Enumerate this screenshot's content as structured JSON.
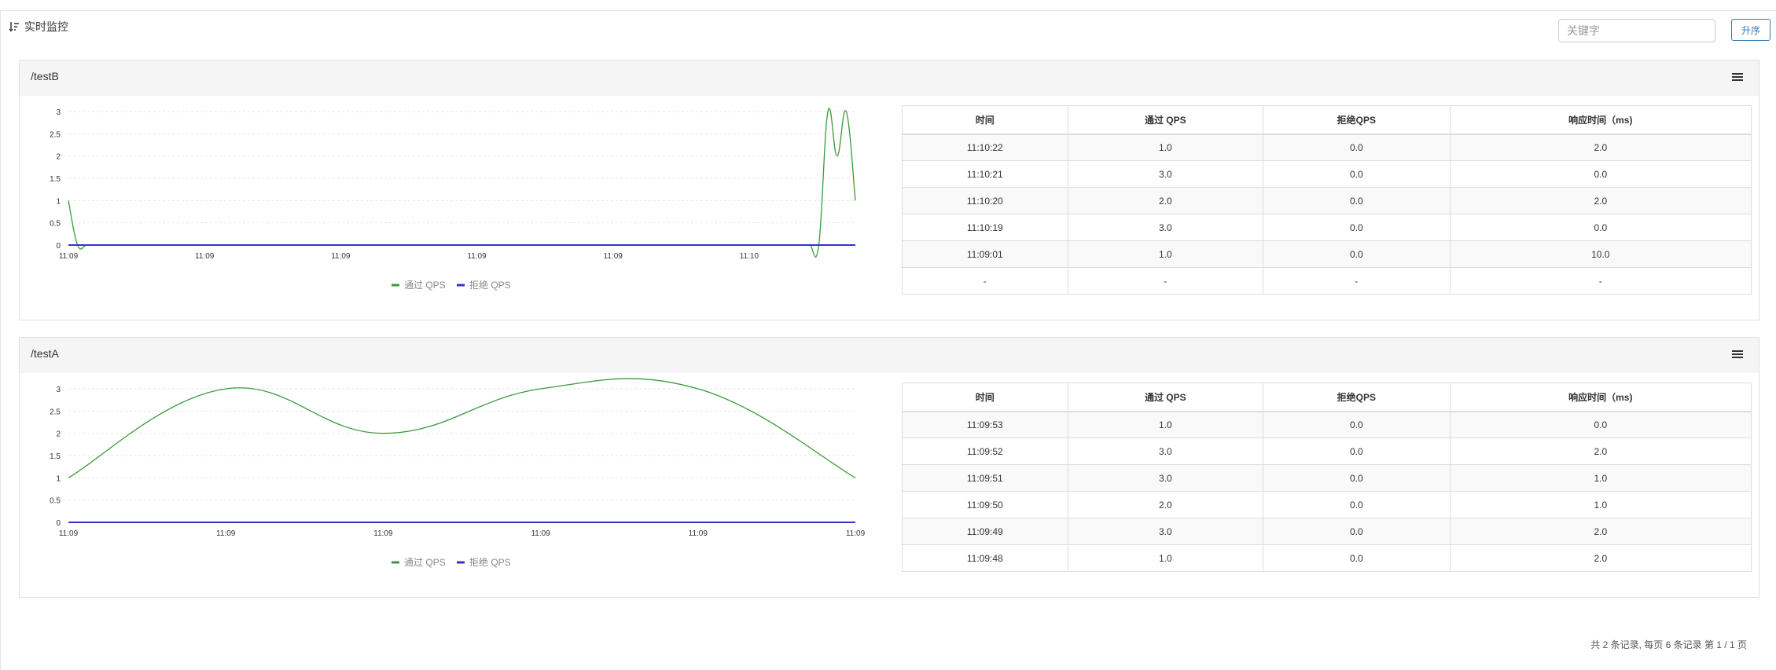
{
  "header": {
    "title": "实时监控",
    "sort_icon": "sort-icon"
  },
  "search": {
    "placeholder": "关键字",
    "value": ""
  },
  "asc_button": {
    "label": "升序"
  },
  "panels": [
    {
      "title": "/testB",
      "table": {
        "headers": [
          "时间",
          "通过 QPS",
          "拒绝QPS",
          "响应时间（ms)"
        ],
        "rows": [
          [
            "11:10:22",
            "1.0",
            "0.0",
            "2.0"
          ],
          [
            "11:10:21",
            "3.0",
            "0.0",
            "0.0"
          ],
          [
            "11:10:20",
            "2.0",
            "0.0",
            "2.0"
          ],
          [
            "11:10:19",
            "3.0",
            "0.0",
            "0.0"
          ],
          [
            "11:09:01",
            "1.0",
            "0.0",
            "10.0"
          ],
          [
            "-",
            "-",
            "-",
            "-"
          ]
        ]
      },
      "chart_data": {
        "type": "line",
        "x_tick_labels": [
          "11:09",
          "11:09",
          "11:09",
          "11:09",
          "11:09",
          "11:10"
        ],
        "y_ticks": [
          "0",
          "0.5",
          "1",
          "1.5",
          "2",
          "2.5",
          "3"
        ],
        "ylim": [
          0,
          3
        ],
        "grid": true,
        "legend_position": "bottom",
        "series": [
          {
            "name": "通过 QPS",
            "color": "#3a9a3a",
            "values": [
              1,
              0,
              0,
              0,
              0,
              0,
              0,
              0,
              0,
              0,
              0,
              0,
              0,
              0,
              0,
              0,
              0,
              0,
              0,
              0,
              0,
              0,
              0,
              0,
              0,
              0,
              0,
              0,
              0,
              0,
              0,
              0,
              0,
              0,
              0,
              0,
              0,
              0,
              0,
              0,
              0,
              0,
              0,
              0,
              0,
              0,
              0,
              0,
              0,
              0,
              0,
              0,
              0,
              0,
              0,
              0,
              0,
              0,
              0,
              0,
              0,
              0,
              0,
              0,
              0,
              0,
              0,
              0,
              0,
              0,
              0,
              0,
              0,
              0,
              0,
              0,
              0,
              0,
              0,
              0,
              0,
              0,
              0,
              3,
              2,
              3,
              1
            ]
          },
          {
            "name": "拒绝 QPS",
            "color": "#3333cc",
            "values": [
              0,
              0,
              0,
              0,
              0,
              0,
              0,
              0,
              0,
              0,
              0,
              0,
              0,
              0,
              0,
              0,
              0,
              0,
              0,
              0,
              0,
              0,
              0,
              0,
              0,
              0,
              0,
              0,
              0,
              0,
              0,
              0,
              0,
              0,
              0,
              0,
              0,
              0,
              0,
              0,
              0,
              0,
              0,
              0,
              0,
              0,
              0,
              0,
              0,
              0,
              0,
              0,
              0,
              0,
              0,
              0,
              0,
              0,
              0,
              0,
              0,
              0,
              0,
              0,
              0,
              0,
              0,
              0,
              0,
              0,
              0,
              0,
              0,
              0,
              0,
              0,
              0,
              0,
              0,
              0,
              0,
              0,
              0,
              0,
              0,
              0,
              0
            ]
          }
        ]
      }
    },
    {
      "title": "/testA",
      "table": {
        "headers": [
          "时间",
          "通过 QPS",
          "拒绝QPS",
          "响应时间（ms)"
        ],
        "rows": [
          [
            "11:09:53",
            "1.0",
            "0.0",
            "0.0"
          ],
          [
            "11:09:52",
            "3.0",
            "0.0",
            "2.0"
          ],
          [
            "11:09:51",
            "3.0",
            "0.0",
            "1.0"
          ],
          [
            "11:09:50",
            "2.0",
            "0.0",
            "1.0"
          ],
          [
            "11:09:49",
            "3.0",
            "0.0",
            "2.0"
          ],
          [
            "11:09:48",
            "1.0",
            "0.0",
            "2.0"
          ]
        ]
      },
      "chart_data": {
        "type": "line",
        "x_tick_labels": [
          "11:09",
          "11:09",
          "11:09",
          "11:09",
          "11:09",
          "11:09"
        ],
        "y_ticks": [
          "0",
          "0.5",
          "1",
          "1.5",
          "2",
          "2.5",
          "3"
        ],
        "ylim": [
          0,
          3
        ],
        "grid": true,
        "legend_position": "bottom",
        "series": [
          {
            "name": "通过 QPS",
            "color": "#3a9a3a",
            "values": [
              1,
              3,
              2,
              3,
              3,
              1
            ]
          },
          {
            "name": "拒绝 QPS",
            "color": "#3333cc",
            "values": [
              0,
              0,
              0,
              0,
              0,
              0
            ]
          }
        ]
      }
    }
  ],
  "pager": {
    "text": "共 2 条记录, 每页 6 条记录 第 1 / 1 页"
  },
  "icons": {
    "menu": "menu-icon"
  }
}
